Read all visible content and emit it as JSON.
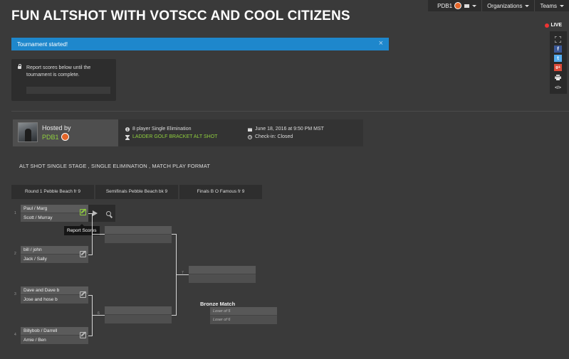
{
  "title": "FUN ALTSHOT WITH VOTSCC AND COOL CITIZENS",
  "nav": {
    "user": "PDB1",
    "organizations": "Organizations",
    "teams": "Teams"
  },
  "alert": {
    "text": "Tournament started!",
    "close": "×"
  },
  "report_box": {
    "text": "Report scores below until the tournament is complete."
  },
  "live": "LIVE",
  "side_buttons": [
    "expand-icon",
    "facebook-icon",
    "twitter-icon",
    "google-plus-icon",
    "print-icon",
    "embed-icon"
  ],
  "side_glyphs": {
    "facebook": "f",
    "twitter": "t",
    "google": "g+",
    "embed": "</>"
  },
  "host": {
    "hosted_by": "Hosted by",
    "name": "PDB1",
    "format": "8 player Single Elimination",
    "game": "LADDER GOLF BRACKET ALT SHOT",
    "date": "June 18, 2016 at 9:50 PM MST",
    "checkin": "Check-in: Closed"
  },
  "description": "ALT SHOT SINGLE STAGE , SINGLE ELIMINATION , MATCH PLAY FORMAT",
  "rounds": [
    "Round 1 Pebble Beach fr 9",
    "Semifinals Pebble Beach bk 9",
    "Finals B O Famous fr 9"
  ],
  "round1": [
    {
      "seed": "1",
      "top": "Paul / Marg",
      "bottom": "Scott / Murray"
    },
    {
      "seed": "2",
      "top": "bill / john",
      "bottom": "Jack / Sally"
    },
    {
      "seed": "3",
      "top": "Dave and Dave b",
      "bottom": "Jose and hose b"
    },
    {
      "seed": "4",
      "top": "Billybob / Darrell",
      "bottom": "Amie / Ben"
    }
  ],
  "tooltip": "Report Scores",
  "match_labels": {
    "sf2": "6",
    "final": "7"
  },
  "bronze": {
    "title": "Bronze Match",
    "top": "Loser of 5",
    "bottom": "Loser of 6"
  },
  "colors": {
    "background": "#3a3a3a",
    "alert": "#1e87cc",
    "accent_green": "#8fcf3e",
    "medal": "#e4662a",
    "live": "#e33333",
    "facebook": "#3b5998",
    "twitter": "#55acee",
    "google_plus": "#dd4b39"
  }
}
